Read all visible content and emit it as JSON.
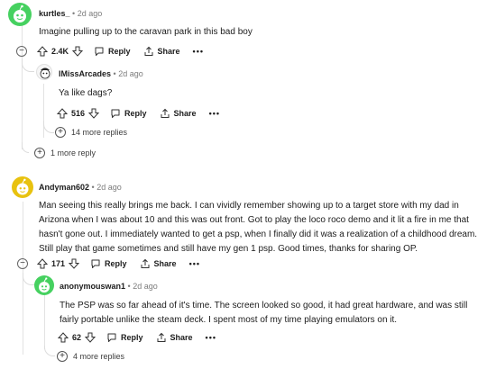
{
  "comments": [
    {
      "username": "kurtles_",
      "time": "2d ago",
      "text": "Imagine pulling up to the caravan park in this bad boy",
      "votes": "2.4K",
      "reply_label": "Reply",
      "share_label": "Share",
      "more_label": "1 more reply",
      "avatar_icon": "snoo-avatar-icon"
    },
    {
      "username": "IMissArcades",
      "time": "2d ago",
      "text": "Ya like dags?",
      "votes": "516",
      "reply_label": "Reply",
      "share_label": "Share",
      "more_label": "14 more replies",
      "avatar_icon": "snoo-avatar-icon"
    },
    {
      "username": "Andyman602",
      "time": "2d ago",
      "text": "Man seeing this really brings me back. I can vividly remember showing up to a target store with my dad in Arizona when I was about 10 and this was out front. Got to play the loco roco demo and it lit a fire in me that hasn't gone out. I immediately wanted to get a psp, when I finally did it was a realization of a childhood dream. Still play that game sometimes and still have my gen 1 psp. Good times, thanks for sharing OP.",
      "votes": "171",
      "reply_label": "Reply",
      "share_label": "Share",
      "avatar_icon": "snoo-avatar-icon"
    },
    {
      "username": "anonymouswan1",
      "time": "2d ago",
      "text": "The PSP was so far ahead of it's time. The screen looked so good, it had great hardware, and was still fairly portable unlike the steam deck. I spent most of my time playing emulators on it.",
      "votes": "62",
      "reply_label": "Reply",
      "share_label": "Share",
      "more_label": "4 more replies",
      "avatar_icon": "snoo-avatar-icon"
    }
  ],
  "separator": "•",
  "overflow": "•••",
  "expand_symbol": "+",
  "collapse_symbol": "−",
  "colors": {
    "avatar_green": "#46d160",
    "avatar_yellow": "#e8c20f",
    "avatar_white": "#f5f5f5",
    "thread_line": "#e2e2e2"
  }
}
